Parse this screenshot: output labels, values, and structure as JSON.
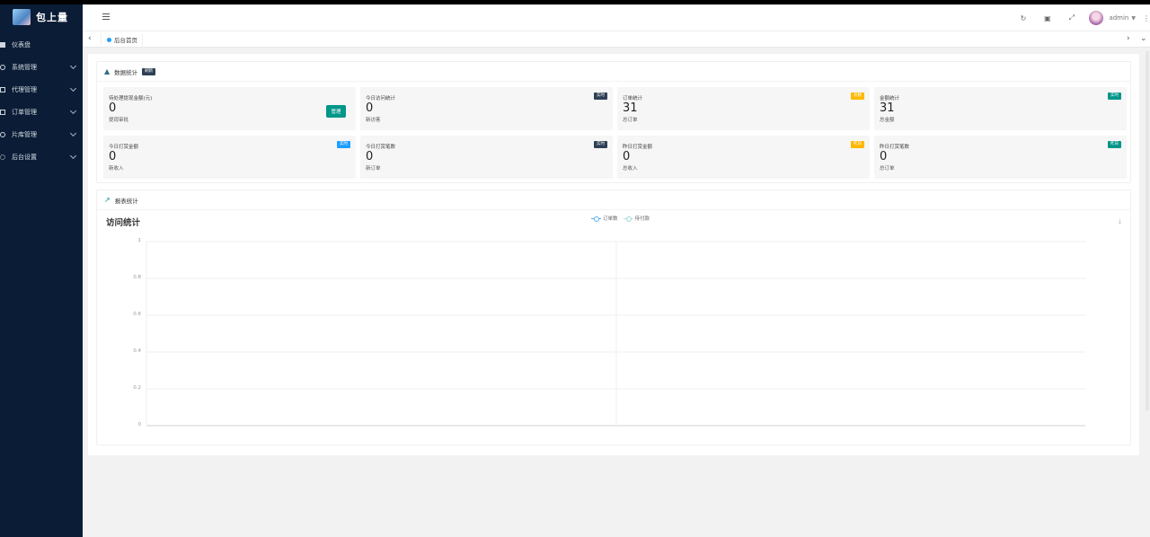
{
  "app": {
    "logo_text": "包上量"
  },
  "sidebar": {
    "items": [
      {
        "label": "仪表盘",
        "icon": "dashboard-icon",
        "has_children": false
      },
      {
        "label": "系统管理",
        "icon": "gear-icon",
        "has_children": true
      },
      {
        "label": "代理管理",
        "icon": "agent-icon",
        "has_children": true
      },
      {
        "label": "订单管理",
        "icon": "order-icon",
        "has_children": true
      },
      {
        "label": "片库管理",
        "icon": "video-library-icon",
        "has_children": true
      },
      {
        "label": "后台设置",
        "icon": "settings-icon",
        "has_children": true
      }
    ]
  },
  "header": {
    "user_name": "admin",
    "icons": [
      "refresh-icon",
      "clear-cache-icon",
      "fullscreen-icon"
    ]
  },
  "tabs": {
    "active": "后台首页"
  },
  "stats_card": {
    "title": "数据统计",
    "title_badge": "刷新",
    "items": [
      {
        "label": "待处理提现金额(元)",
        "value": "0",
        "sub": "提现审批",
        "tag": null,
        "button": "管理"
      },
      {
        "label": "今日访问统计",
        "value": "0",
        "sub": "新访客",
        "tag": "实时"
      },
      {
        "label": "订单统计",
        "value": "31",
        "sub": "总订单",
        "tag": "总数"
      },
      {
        "label": "金额统计",
        "value": "31",
        "sub": "总金额",
        "tag": "实时"
      },
      {
        "label": "今日打赏金额",
        "value": "0",
        "sub": "新收入",
        "tag": "实时"
      },
      {
        "label": "今日打赏笔数",
        "value": "0",
        "sub": "新订单",
        "tag": "实时"
      },
      {
        "label": "昨日打赏金额",
        "value": "0",
        "sub": "总收入",
        "tag": "昨日"
      },
      {
        "label": "昨日打赏笔数",
        "value": "0",
        "sub": "总订单",
        "tag": "昨日"
      }
    ],
    "tag_colors": [
      "#1e9fff",
      "#2f4056",
      "#ffb800",
      "#009688"
    ]
  },
  "report_card": {
    "title": "报表统计"
  },
  "chart_data": {
    "type": "line",
    "title": "访问统计",
    "series": [
      {
        "name": "订单数",
        "values": [],
        "color": "#5ab1ef"
      },
      {
        "name": "待付款",
        "values": [],
        "color": "#b6e3e3"
      }
    ],
    "ylim": [
      0,
      1
    ],
    "yticks": [
      "1",
      "0.8",
      "0.6",
      "0.4",
      "0.2",
      "0"
    ],
    "xcategories": [],
    "grid": true,
    "legend": "top-center"
  }
}
